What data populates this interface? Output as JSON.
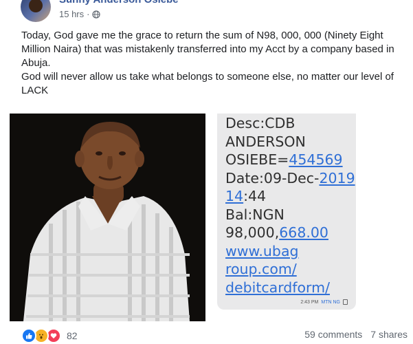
{
  "post": {
    "author": "Sunny Anderson Osiebe",
    "time": "15 hrs",
    "separator": "·",
    "audience_icon": "globe-icon",
    "paragraph_1": "Today, God gave me the grace to return the sum of N98, 000, 000 (Ninety Eight Million Naira) that was mistakenly transferred into my Acct by a company based in Abuja.",
    "paragraph_2": "God will never allow us take what belongs to someone else, no matter our level of LACK"
  },
  "sms": {
    "desc_line": "Desc:CDB",
    "name_line_1": "ANDERSON",
    "name_line_2_text": "OSIEBE=",
    "name_line_2_link": "454569",
    "date_text": "Date:09-Dec-",
    "date_link": "2019",
    "time_link": "14",
    "time_text": ":44",
    "bal_line": "Bal:NGN",
    "bal_text": "98,000,",
    "bal_link": "668.00",
    "url_1": "www.ubag",
    "url_2": "roup.com/",
    "url_3": "debitcardform/",
    "sent_time": "2:43 PM",
    "carrier": "MTN NG"
  },
  "footer": {
    "reaction_icons": [
      "like-icon",
      "wow-icon",
      "love-icon"
    ],
    "reaction_count": "82",
    "comments": "59 comments",
    "shares": "7 shares"
  },
  "colors": {
    "author": "#385898",
    "like": "#1877f2",
    "wow": "#f7b125",
    "love": "#f33e58",
    "sms_link": "#2f6fd6",
    "sms_bubble": "#e9e9ea"
  }
}
